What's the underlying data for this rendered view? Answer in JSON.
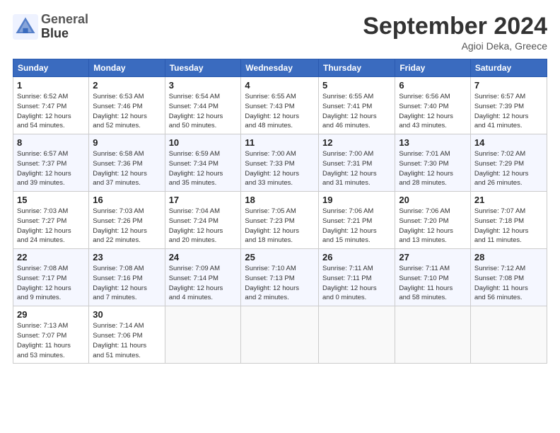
{
  "header": {
    "logo_line1": "General",
    "logo_line2": "Blue",
    "month_title": "September 2024",
    "location": "Agioi Deka, Greece"
  },
  "columns": [
    "Sunday",
    "Monday",
    "Tuesday",
    "Wednesday",
    "Thursday",
    "Friday",
    "Saturday"
  ],
  "weeks": [
    [
      {
        "day": "1",
        "rise": "6:52 AM",
        "set": "7:47 PM",
        "hours": "12 hours",
        "mins": "54 minutes."
      },
      {
        "day": "2",
        "rise": "6:53 AM",
        "set": "7:46 PM",
        "hours": "12 hours",
        "mins": "52 minutes."
      },
      {
        "day": "3",
        "rise": "6:54 AM",
        "set": "7:44 PM",
        "hours": "12 hours",
        "mins": "50 minutes."
      },
      {
        "day": "4",
        "rise": "6:55 AM",
        "set": "7:43 PM",
        "hours": "12 hours",
        "mins": "48 minutes."
      },
      {
        "day": "5",
        "rise": "6:55 AM",
        "set": "7:41 PM",
        "hours": "12 hours",
        "mins": "46 minutes."
      },
      {
        "day": "6",
        "rise": "6:56 AM",
        "set": "7:40 PM",
        "hours": "12 hours",
        "mins": "43 minutes."
      },
      {
        "day": "7",
        "rise": "6:57 AM",
        "set": "7:39 PM",
        "hours": "12 hours",
        "mins": "41 minutes."
      }
    ],
    [
      {
        "day": "8",
        "rise": "6:57 AM",
        "set": "7:37 PM",
        "hours": "12 hours",
        "mins": "39 minutes."
      },
      {
        "day": "9",
        "rise": "6:58 AM",
        "set": "7:36 PM",
        "hours": "12 hours",
        "mins": "37 minutes."
      },
      {
        "day": "10",
        "rise": "6:59 AM",
        "set": "7:34 PM",
        "hours": "12 hours",
        "mins": "35 minutes."
      },
      {
        "day": "11",
        "rise": "7:00 AM",
        "set": "7:33 PM",
        "hours": "12 hours",
        "mins": "33 minutes."
      },
      {
        "day": "12",
        "rise": "7:00 AM",
        "set": "7:31 PM",
        "hours": "12 hours",
        "mins": "31 minutes."
      },
      {
        "day": "13",
        "rise": "7:01 AM",
        "set": "7:30 PM",
        "hours": "12 hours",
        "mins": "28 minutes."
      },
      {
        "day": "14",
        "rise": "7:02 AM",
        "set": "7:29 PM",
        "hours": "12 hours",
        "mins": "26 minutes."
      }
    ],
    [
      {
        "day": "15",
        "rise": "7:03 AM",
        "set": "7:27 PM",
        "hours": "12 hours",
        "mins": "24 minutes."
      },
      {
        "day": "16",
        "rise": "7:03 AM",
        "set": "7:26 PM",
        "hours": "12 hours",
        "mins": "22 minutes."
      },
      {
        "day": "17",
        "rise": "7:04 AM",
        "set": "7:24 PM",
        "hours": "12 hours",
        "mins": "20 minutes."
      },
      {
        "day": "18",
        "rise": "7:05 AM",
        "set": "7:23 PM",
        "hours": "12 hours",
        "mins": "18 minutes."
      },
      {
        "day": "19",
        "rise": "7:06 AM",
        "set": "7:21 PM",
        "hours": "12 hours",
        "mins": "15 minutes."
      },
      {
        "day": "20",
        "rise": "7:06 AM",
        "set": "7:20 PM",
        "hours": "12 hours",
        "mins": "13 minutes."
      },
      {
        "day": "21",
        "rise": "7:07 AM",
        "set": "7:18 PM",
        "hours": "12 hours",
        "mins": "11 minutes."
      }
    ],
    [
      {
        "day": "22",
        "rise": "7:08 AM",
        "set": "7:17 PM",
        "hours": "12 hours",
        "mins": "9 minutes."
      },
      {
        "day": "23",
        "rise": "7:08 AM",
        "set": "7:16 PM",
        "hours": "12 hours",
        "mins": "7 minutes."
      },
      {
        "day": "24",
        "rise": "7:09 AM",
        "set": "7:14 PM",
        "hours": "12 hours",
        "mins": "4 minutes."
      },
      {
        "day": "25",
        "rise": "7:10 AM",
        "set": "7:13 PM",
        "hours": "12 hours",
        "mins": "2 minutes."
      },
      {
        "day": "26",
        "rise": "7:11 AM",
        "set": "7:11 PM",
        "hours": "12 hours",
        "mins": "0 minutes."
      },
      {
        "day": "27",
        "rise": "7:11 AM",
        "set": "7:10 PM",
        "hours": "11 hours",
        "mins": "58 minutes."
      },
      {
        "day": "28",
        "rise": "7:12 AM",
        "set": "7:08 PM",
        "hours": "11 hours",
        "mins": "56 minutes."
      }
    ],
    [
      {
        "day": "29",
        "rise": "7:13 AM",
        "set": "7:07 PM",
        "hours": "11 hours",
        "mins": "53 minutes."
      },
      {
        "day": "30",
        "rise": "7:14 AM",
        "set": "7:06 PM",
        "hours": "11 hours",
        "mins": "51 minutes."
      },
      null,
      null,
      null,
      null,
      null
    ]
  ]
}
